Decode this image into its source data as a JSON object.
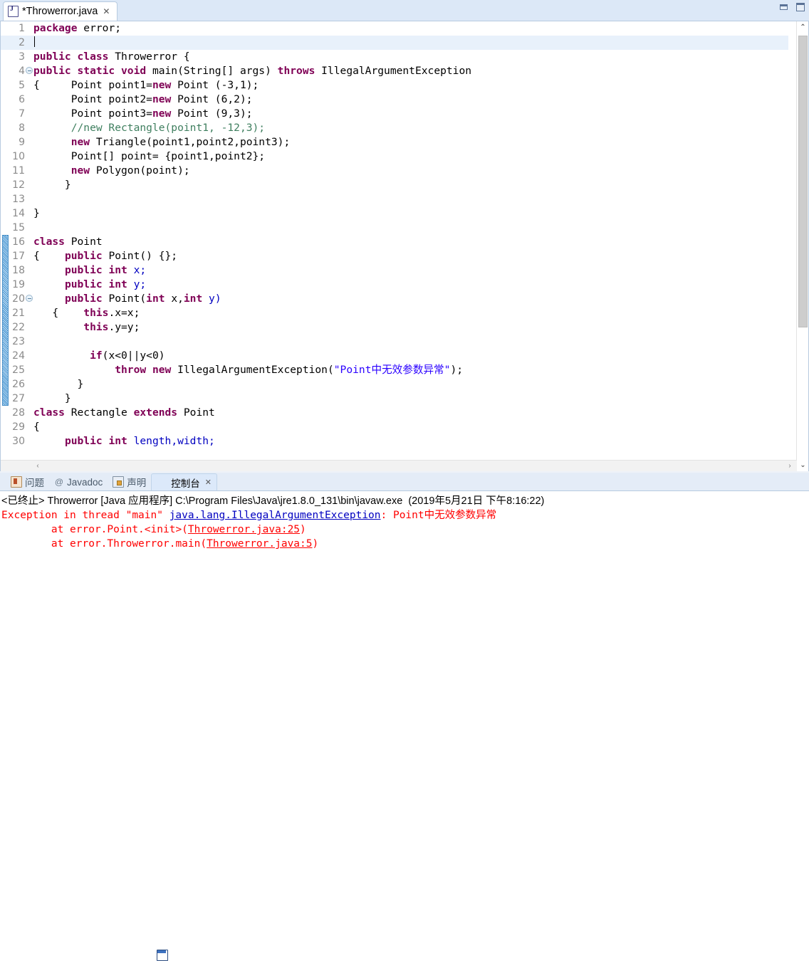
{
  "window": {
    "minimize_label": "minimize",
    "maximize_label": "maximize"
  },
  "editor_tab": {
    "title": "*Throwerror.java",
    "close": "✕",
    "icon": "java-file-icon"
  },
  "code": {
    "lines": [
      {
        "n": "1",
        "fold": false,
        "current": false,
        "segments": [
          {
            "t": "package",
            "c": "kw"
          },
          {
            "t": " error;",
            "c": "pl"
          }
        ]
      },
      {
        "n": "2",
        "fold": false,
        "current": true,
        "segments": [],
        "caret": true
      },
      {
        "n": "3",
        "fold": false,
        "current": false,
        "segments": [
          {
            "t": "public class",
            "c": "kw"
          },
          {
            "t": " Throwerror {",
            "c": "pl"
          }
        ]
      },
      {
        "n": "4",
        "fold": true,
        "current": false,
        "segments": [
          {
            "t": "public static void",
            "c": "kw"
          },
          {
            "t": " main(String[] args) ",
            "c": "pl"
          },
          {
            "t": "throws",
            "c": "kw"
          },
          {
            "t": " IllegalArgumentException",
            "c": "pl"
          }
        ]
      },
      {
        "n": "5",
        "fold": false,
        "current": false,
        "segments": [
          {
            "t": "{     Point point1=",
            "c": "pl"
          },
          {
            "t": "new",
            "c": "kw"
          },
          {
            "t": " Point (-3,1);",
            "c": "pl"
          }
        ]
      },
      {
        "n": "6",
        "fold": false,
        "current": false,
        "segments": [
          {
            "t": "      Point point2=",
            "c": "pl"
          },
          {
            "t": "new",
            "c": "kw"
          },
          {
            "t": " Point (6,2);",
            "c": "pl"
          }
        ]
      },
      {
        "n": "7",
        "fold": false,
        "current": false,
        "segments": [
          {
            "t": "      Point point3=",
            "c": "pl"
          },
          {
            "t": "new",
            "c": "kw"
          },
          {
            "t": " Point (9,3);",
            "c": "pl"
          }
        ]
      },
      {
        "n": "8",
        "fold": false,
        "current": false,
        "segments": [
          {
            "t": "      //new Rectangle(point1, -12,3);",
            "c": "cmt"
          }
        ]
      },
      {
        "n": "9",
        "fold": false,
        "current": false,
        "segments": [
          {
            "t": "      ",
            "c": "pl"
          },
          {
            "t": "new",
            "c": "kw"
          },
          {
            "t": " Triangle(point1,point2,point3);",
            "c": "pl"
          }
        ]
      },
      {
        "n": "10",
        "fold": false,
        "current": false,
        "segments": [
          {
            "t": "      Point[] point= {point1,point2};",
            "c": "pl"
          }
        ]
      },
      {
        "n": "11",
        "fold": false,
        "current": false,
        "segments": [
          {
            "t": "      ",
            "c": "pl"
          },
          {
            "t": "new",
            "c": "kw"
          },
          {
            "t": " Polygon(point);",
            "c": "pl"
          }
        ]
      },
      {
        "n": "12",
        "fold": false,
        "current": false,
        "segments": [
          {
            "t": "     }",
            "c": "pl"
          }
        ]
      },
      {
        "n": "13",
        "fold": false,
        "current": false,
        "segments": []
      },
      {
        "n": "14",
        "fold": false,
        "current": false,
        "segments": [
          {
            "t": "}",
            "c": "pl"
          }
        ]
      },
      {
        "n": "15",
        "fold": false,
        "current": false,
        "segments": []
      },
      {
        "n": "16",
        "fold": false,
        "current": false,
        "segments": [
          {
            "t": "class",
            "c": "kw"
          },
          {
            "t": " Point",
            "c": "pl"
          }
        ]
      },
      {
        "n": "17",
        "fold": false,
        "current": false,
        "segments": [
          {
            "t": "{    ",
            "c": "pl"
          },
          {
            "t": "public",
            "c": "kw"
          },
          {
            "t": " Point() {};",
            "c": "pl"
          }
        ]
      },
      {
        "n": "18",
        "fold": false,
        "current": false,
        "segments": [
          {
            "t": "     ",
            "c": "pl"
          },
          {
            "t": "public int",
            "c": "kw"
          },
          {
            "t": " ",
            "c": "pl"
          },
          {
            "t": "x;",
            "c": "fld"
          }
        ]
      },
      {
        "n": "19",
        "fold": false,
        "current": false,
        "segments": [
          {
            "t": "     ",
            "c": "pl"
          },
          {
            "t": "public int",
            "c": "kw"
          },
          {
            "t": " ",
            "c": "pl"
          },
          {
            "t": "y;",
            "c": "fld"
          }
        ]
      },
      {
        "n": "20",
        "fold": true,
        "current": false,
        "segments": [
          {
            "t": "     ",
            "c": "pl"
          },
          {
            "t": "public",
            "c": "kw"
          },
          {
            "t": " Point(",
            "c": "pl"
          },
          {
            "t": "int",
            "c": "kw"
          },
          {
            "t": " x,",
            "c": "pl"
          },
          {
            "t": "int",
            "c": "kw"
          },
          {
            "t": " ",
            "c": "pl"
          },
          {
            "t": "y)",
            "c": "fld"
          }
        ]
      },
      {
        "n": "21",
        "fold": false,
        "current": false,
        "segments": [
          {
            "t": "   {    ",
            "c": "pl"
          },
          {
            "t": "this",
            "c": "kw"
          },
          {
            "t": ".x=x;",
            "c": "pl"
          }
        ]
      },
      {
        "n": "22",
        "fold": false,
        "current": false,
        "segments": [
          {
            "t": "        ",
            "c": "pl"
          },
          {
            "t": "this",
            "c": "kw"
          },
          {
            "t": ".y=y;",
            "c": "pl"
          }
        ]
      },
      {
        "n": "23",
        "fold": false,
        "current": false,
        "segments": []
      },
      {
        "n": "24",
        "fold": false,
        "current": false,
        "segments": [
          {
            "t": "         ",
            "c": "pl"
          },
          {
            "t": "if",
            "c": "kw"
          },
          {
            "t": "(x<0||y<0)",
            "c": "pl"
          }
        ]
      },
      {
        "n": "25",
        "fold": false,
        "current": false,
        "segments": [
          {
            "t": "             ",
            "c": "pl"
          },
          {
            "t": "throw new",
            "c": "kw"
          },
          {
            "t": " IllegalArgumentException(",
            "c": "pl"
          },
          {
            "t": "\"Point中无效参数异常\"",
            "c": "str"
          },
          {
            "t": ");",
            "c": "pl"
          }
        ]
      },
      {
        "n": "26",
        "fold": false,
        "current": false,
        "segments": [
          {
            "t": "       }",
            "c": "pl"
          }
        ]
      },
      {
        "n": "27",
        "fold": false,
        "current": false,
        "segments": [
          {
            "t": "     }",
            "c": "pl"
          }
        ]
      },
      {
        "n": "28",
        "fold": false,
        "current": false,
        "segments": [
          {
            "t": "class",
            "c": "kw"
          },
          {
            "t": " Rectangle ",
            "c": "pl"
          },
          {
            "t": "extends",
            "c": "kw"
          },
          {
            "t": " Point",
            "c": "pl"
          }
        ]
      },
      {
        "n": "29",
        "fold": false,
        "current": false,
        "segments": [
          {
            "t": "{",
            "c": "pl"
          }
        ]
      },
      {
        "n": "30",
        "fold": false,
        "current": false,
        "segments": [
          {
            "t": "     ",
            "c": "pl"
          },
          {
            "t": "public int",
            "c": "kw"
          },
          {
            "t": " ",
            "c": "pl"
          },
          {
            "t": "length,width;",
            "c": "fld"
          }
        ]
      }
    ],
    "change_marker_first_line": 16,
    "change_marker_last_line": 27
  },
  "scrollbars": {
    "v_up": "⌃",
    "v_down": "⌄",
    "h_left": "‹",
    "h_right": "›"
  },
  "console_panel": {
    "tabs": [
      {
        "label": "问题",
        "icon": "problems-icon",
        "active": false,
        "closable": false
      },
      {
        "label": "Javadoc",
        "icon": "javadoc-icon",
        "active": false,
        "closable": false
      },
      {
        "label": "声明",
        "icon": "declaration-icon",
        "active": false,
        "closable": false
      },
      {
        "label": "控制台",
        "icon": "console-icon",
        "active": true,
        "closable": true
      }
    ],
    "close_glyph": "✕",
    "header": "<已终止> Throwerror [Java 应用程序] C:\\Program Files\\Java\\jre1.8.0_131\\bin\\javaw.exe  (2019年5月21日 下午8:16:22)",
    "output": {
      "exception_prefix": "Exception in thread \"main\" ",
      "exception_class": "java.lang.IllegalArgumentException",
      "exception_sep": ": ",
      "exception_message": "Point中无效参数异常",
      "frames": [
        {
          "prefix": "\tat error.Point.<init>(",
          "link": "Throwerror.java:25",
          "suffix": ")"
        },
        {
          "prefix": "\tat error.Throwerror.main(",
          "link": "Throwerror.java:5",
          "suffix": ")"
        }
      ]
    }
  },
  "colors": {
    "keyword": "#7f0055",
    "string": "#2a00ff",
    "comment": "#3f7f5f",
    "field": "#0000c0",
    "error": "#ff0000",
    "link": "#0000c0",
    "tab_active_bg": "#dce9fa"
  }
}
